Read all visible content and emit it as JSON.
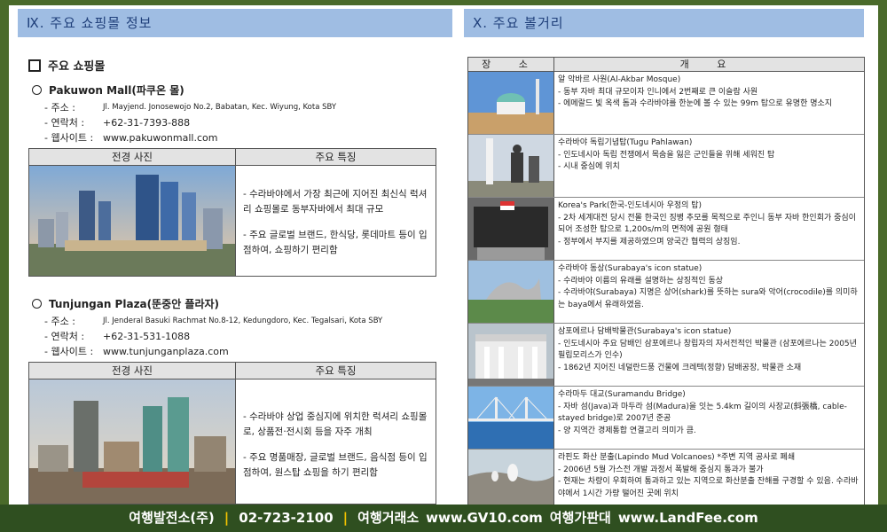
{
  "left": {
    "section_title": "Ⅸ. 주요 쇼핑몰 정보",
    "subsection_title": "주요 쇼핑몰",
    "malls": [
      {
        "name": "Pakuwon Mall(파쿠온 몰)",
        "address_label": "- 주소 :",
        "address": "Jl. Mayjend. Jonosewojo No.2, Babatan, Kec. Wiyung, Kota SBY",
        "phone_label": "- 연락처 :",
        "phone": "+62-31-7393-888",
        "website_label": "- 웹사이트 :",
        "website": "www.pakuwonmall.com",
        "photo_header": "전경 사진",
        "features_header": "주요 특징",
        "features": [
          "- 수라바야에서 가장 최근에 지어진 최신식 럭셔리 쇼핑몰로 동부자바에서 최대 규모",
          "- 주요 글로벌 브랜드, 한식당, 롯데마트 등이 입점하여, 쇼핑하기 편리함"
        ]
      },
      {
        "name": "Tunjungan Plaza(뚠중안 플라자)",
        "address_label": "- 주소 :",
        "address": "Jl. Jenderal Basuki Rachmat No.8-12, Kedungdoro, Kec. Tegalsari, Kota SBY",
        "phone_label": "- 연락처 :",
        "phone": "+62-31-531-1088",
        "website_label": "- 웹사이트 :",
        "website": "www.tunjunganplaza.com",
        "photo_header": "전경 사진",
        "features_header": "주요 특징",
        "features": [
          "- 수라바야 상업 중심지에 위치한 럭셔리 쇼핑몰로, 상품전·전시회 등을 자주 개최",
          "- 주요 명품매장, 글로벌 브랜드, 음식점 등이 입점하여, 원스탑 쇼핑을 하기 편리함"
        ]
      }
    ]
  },
  "right": {
    "section_title": "Ⅹ. 주요 볼거리",
    "col_place": "장 소",
    "col_summary": "개 요",
    "sights": [
      {
        "title": "알 악바르 사원(Al-Akbar Mosque)",
        "lines": [
          "- 동부 자바 최대 규모이자 인니에서 2번째로 큰 이슬람 사원",
          "- 에메랄드 빛 옥색 돔과 수라바야를 한눈에 볼 수 있는 99m 탑으로 유명한 명소지"
        ]
      },
      {
        "title": "수라바야 독립기념탑(Tugu Pahlawan)",
        "lines": [
          "- 인도네시아 독립 전쟁에서 목숨을 잃은 군인들을 위해 세워진 탑",
          "- 시내 중심에 위치"
        ]
      },
      {
        "title": "Korea's Park(한국-인도네시아 우정의 탑)",
        "lines": [
          "- 2차 세계대전 당시 전몰 한국인 징병 추모를 목적으로 주인니 동부 자바 한인회가 중심이 되어 조성한 탑으로 1,200s/m의 면적에 공원 형태",
          "- 정부에서 부지를 제공하였으며 양국간 협력의 상징임."
        ]
      },
      {
        "title": "수라바야 동상(Surabaya's icon statue)",
        "lines": [
          "- 수라바야 이름의 유래를 설명하는 상징적인 동상",
          "- 수라바야(Surabaya) 지명은 상어(shark)를 뜻하는 sura와 악어(crocodile)를 의미하는 baya에서 유래하였음."
        ]
      },
      {
        "title": "삼포에르나 담배박물관(Surabaya's icon statue)",
        "lines": [
          "- 인도네시아 주요 담배인 삼포에르나 창립자의 자서전적인 박물관 (삼포에르나는 2005년 필립모리스가 인수)",
          "- 1862년 지어진 네덜란드풍 건물에 크레텍(정향) 담배공장, 박물관 소재"
        ]
      },
      {
        "title": "수라마두 대교(Suramandu Bridge)",
        "lines": [
          "- 자바 섬(Java)과 마두라 섬(Madura)을 잇는 5.4km 길이의 사장교(斜張橋, cable-stayed bridge)로 2007년 준공",
          "- 양 지역간 경제통합 연결고리 의미가 큼."
        ]
      },
      {
        "title": "라핀도 화산 분출(Lapindo Mud Volcanoes) *주변 지역 공사로 폐쇄",
        "lines": [
          "- 2006년 5월 가스전 개발 과정서 폭발해 중심지 통과가 불가",
          "- 현재는 차량이 우회하여 통과하고 있는 지역으로 화산분출 잔해를 구경할 수 있음. 수라바야에서 1시간 가량 떨어진 곳에 위치"
        ]
      }
    ]
  },
  "footer": {
    "company": "여행발전소(주)",
    "phone": "02-723-2100",
    "exchange": "여행거래소",
    "site1": "www.GV10.com",
    "seller": "여행가판대",
    "site2": "www.LandFee.com",
    "separator": "|"
  }
}
